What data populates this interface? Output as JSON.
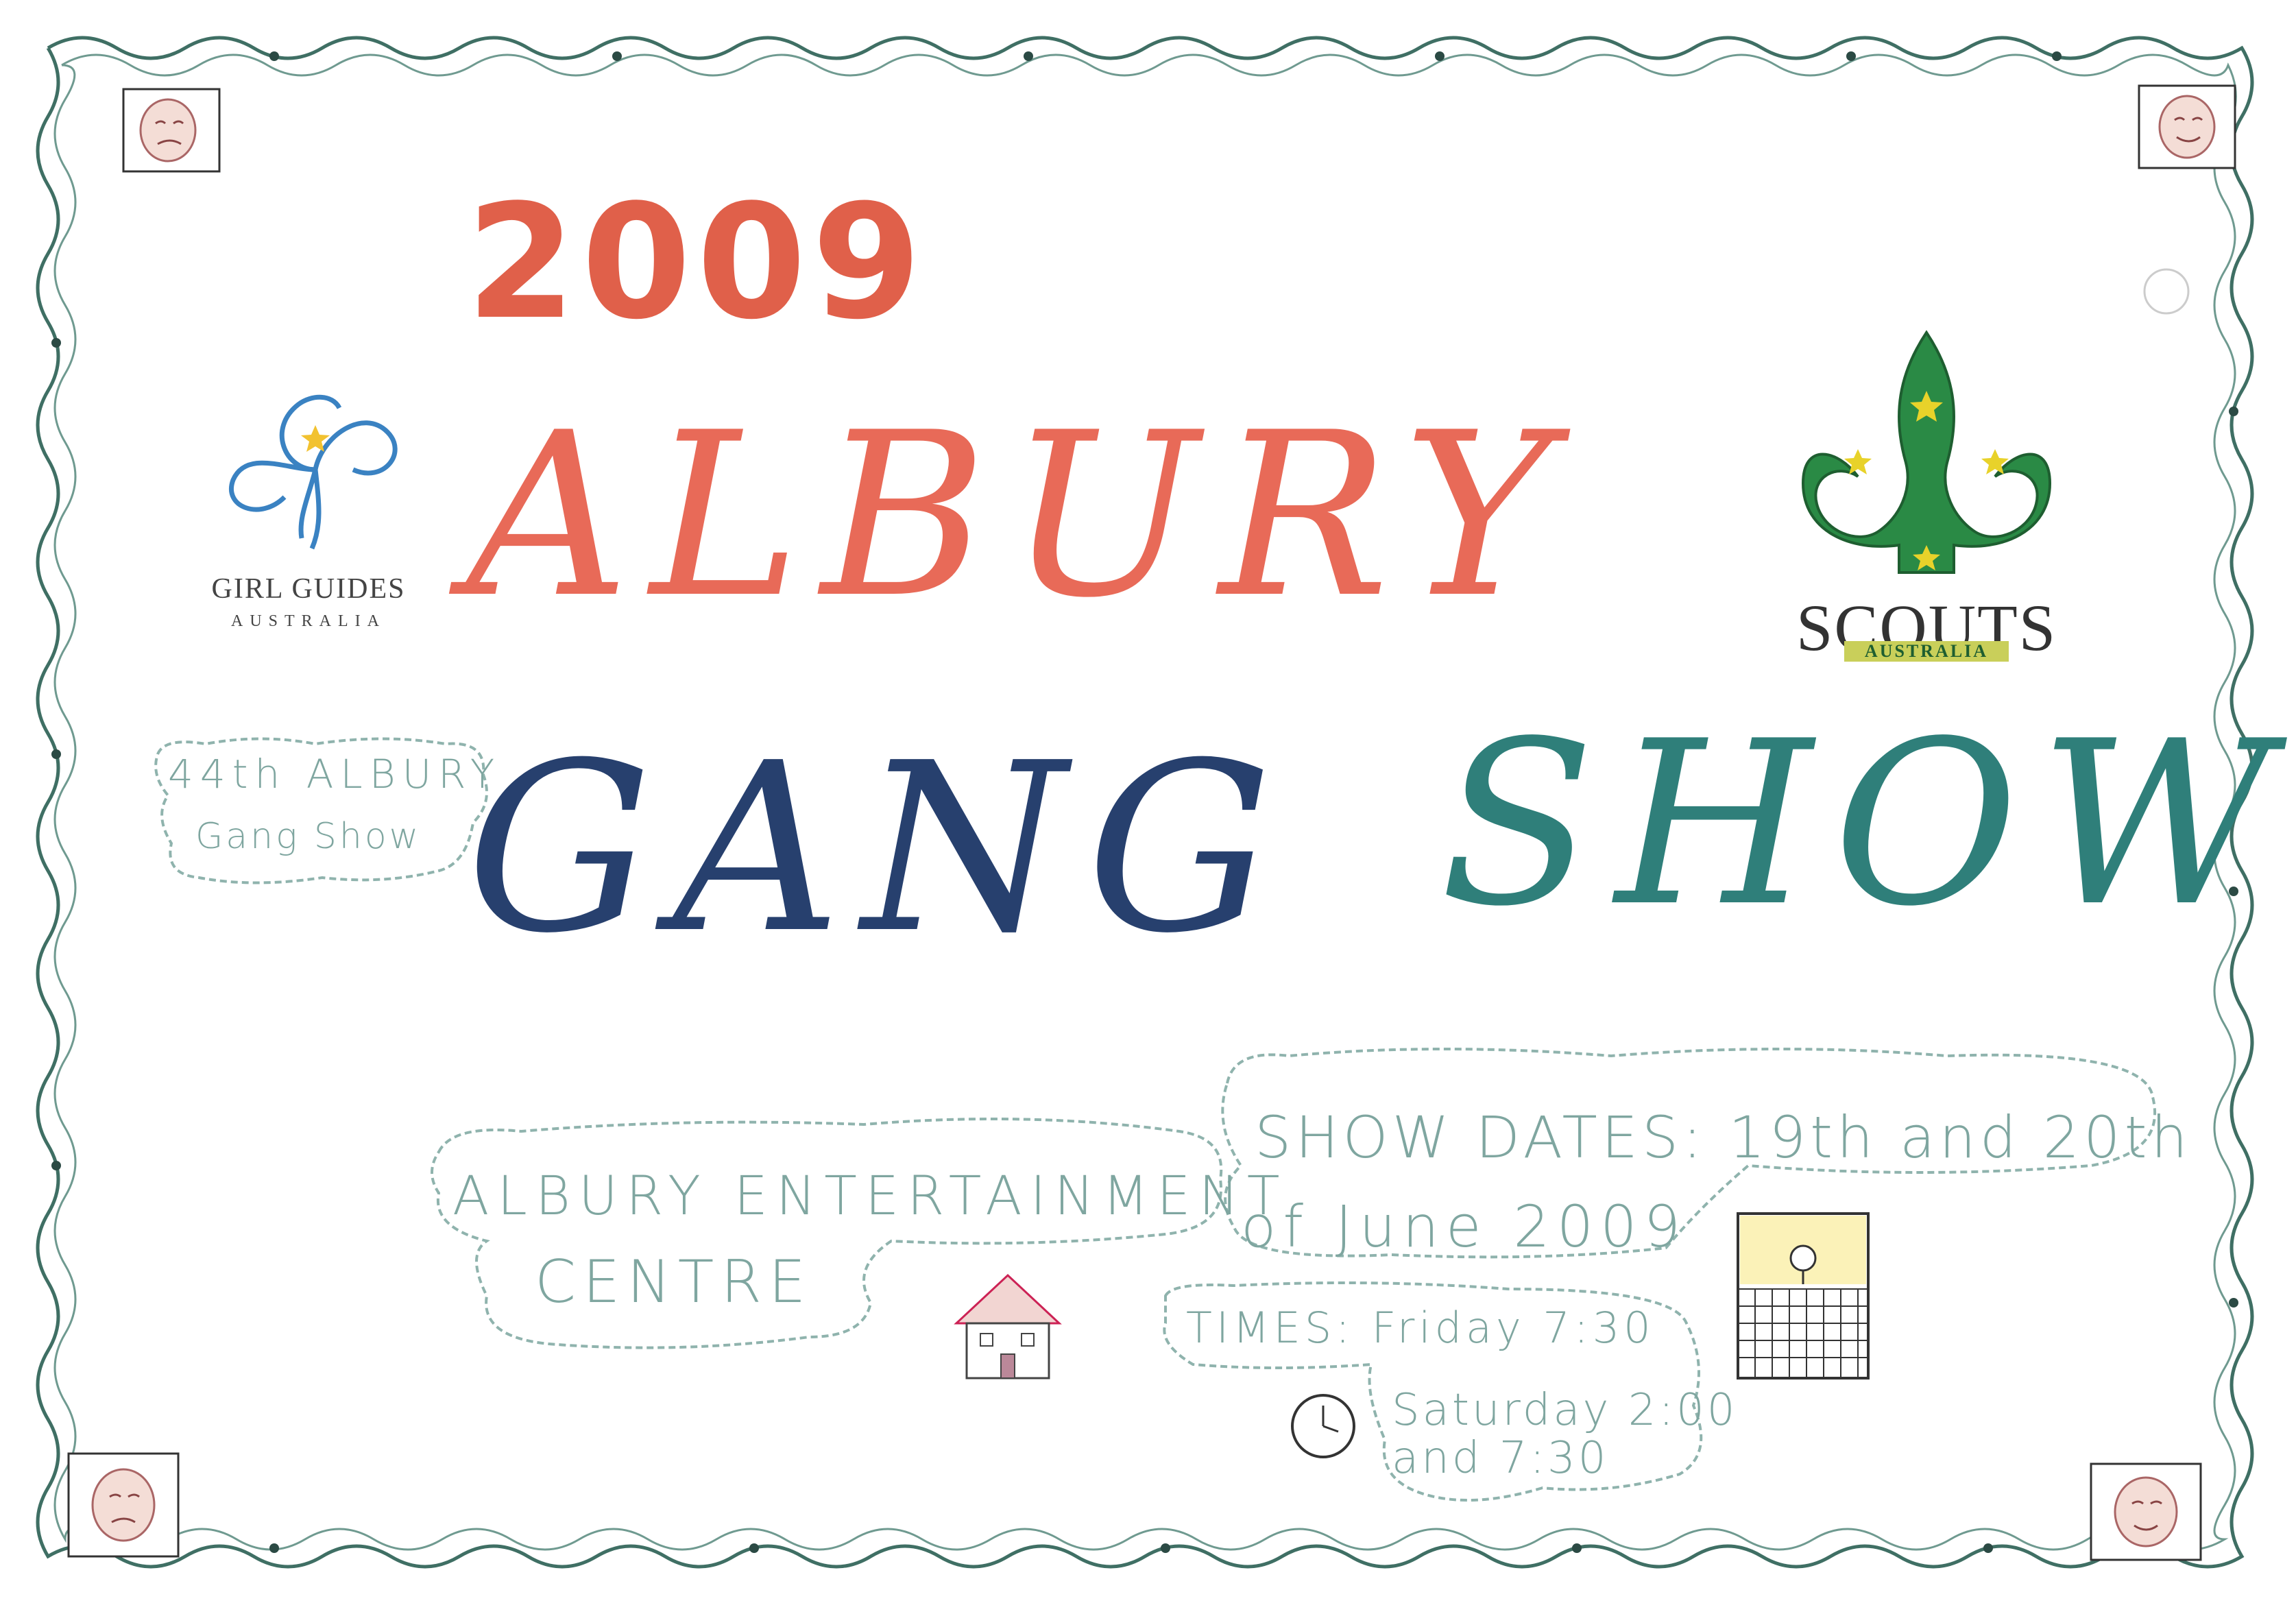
{
  "poster": {
    "year": "2009",
    "title_line1": "ALBURY",
    "title_line2a": "GANG",
    "title_line2b": "SHOW"
  },
  "logos": {
    "girl_guides_name": "GIRL GUIDES",
    "girl_guides_country": "AUSTRALIA",
    "scouts_name": "SCOUTS",
    "scouts_country": "AUSTRALIA"
  },
  "notes": {
    "edition_line1": "44th ALBURY",
    "edition_line2": "Gang Show",
    "venue_line1": "ALBURY ENTERTAINMENT",
    "venue_line2": "CENTRE",
    "dates_line1": "SHOW DATES: 19th and 20th",
    "dates_line2": "of June 2009",
    "times_line1": "TIMES: Friday 7:30",
    "times_line2": "Saturday 2:00",
    "times_line3": "and 7:30"
  },
  "colors": {
    "year_red": "#e0604a",
    "albury_red": "#e86a58",
    "gang_navy": "#27406e",
    "show_teal": "#2f7f7a",
    "border_green": "#3f6f64",
    "guides_blue": "#3a82c2",
    "scouts_green": "#2a8a45",
    "scouts_gold": "#e8d22a",
    "pencil_teal": "#7fa6a0"
  },
  "icons": [
    "theatre-mask-icon",
    "house-icon",
    "clock-icon",
    "window-person-icon",
    "trefoil-icon",
    "fleur-de-lis-icon"
  ]
}
